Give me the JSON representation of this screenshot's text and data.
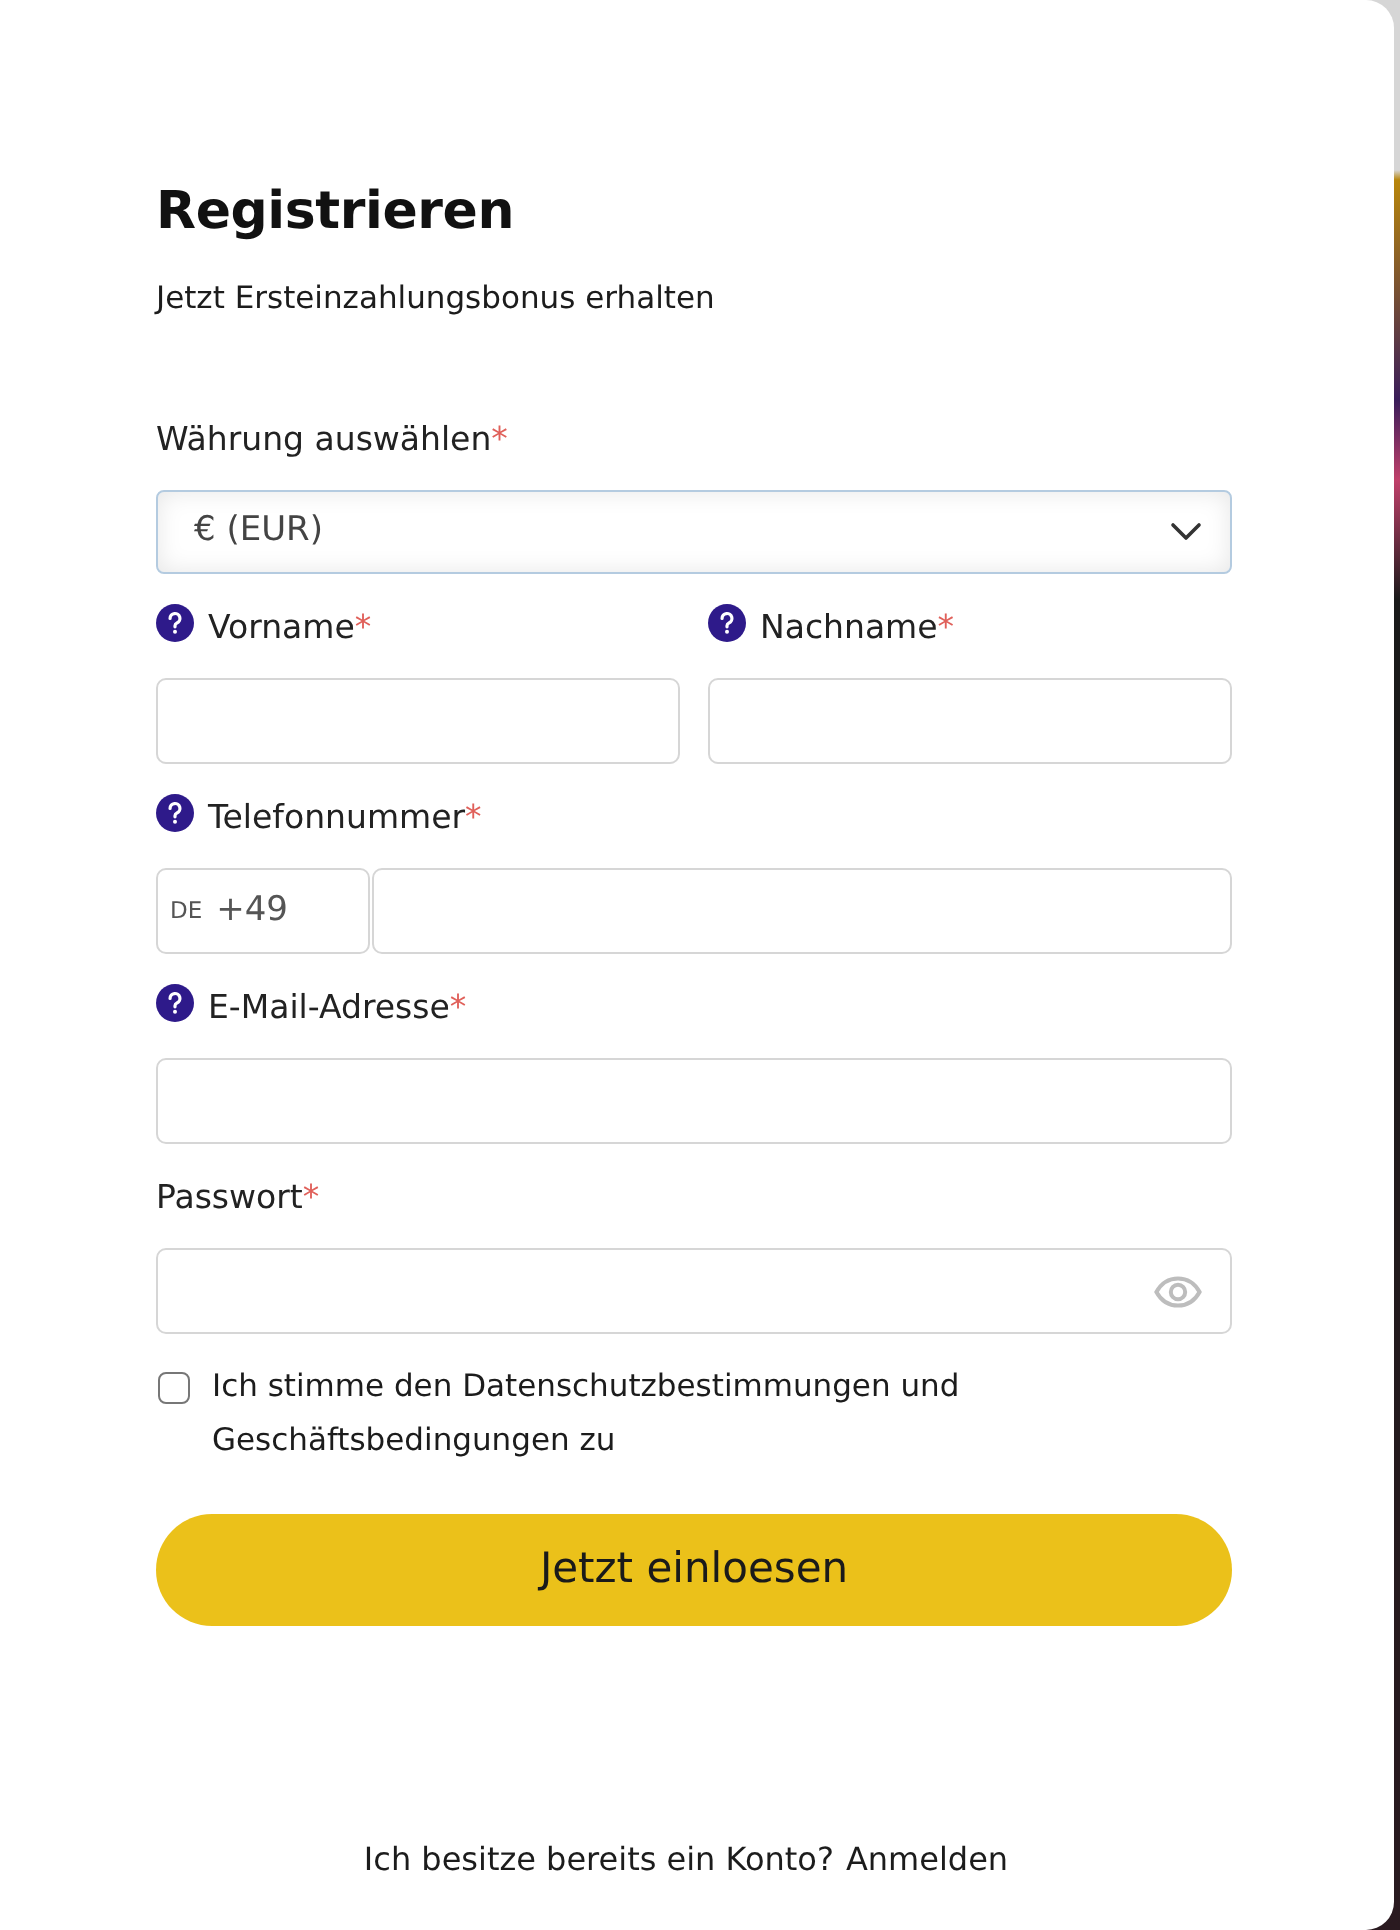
{
  "title": "Registrieren",
  "subtitle": "Jetzt Ersteinzahlungsbonus erhalten",
  "fields": [
    {
      "kind": "select",
      "label": "Währung auswählen",
      "marker": "*",
      "help": false,
      "value": "€ (EUR)"
    },
    {
      "kind": "pair",
      "items": [
        {
          "label": "Vorname",
          "marker": "*",
          "help": true
        },
        {
          "label": "Nachname",
          "marker": "*",
          "help": true
        }
      ]
    },
    {
      "kind": "phone",
      "label": "Telefonnummer",
      "marker": "*",
      "help": true,
      "country": "DE",
      "prefix": "+49"
    },
    {
      "kind": "text",
      "label": "E-Mail-Adresse",
      "marker": "*",
      "help": true
    },
    {
      "kind": "password",
      "label": "Passwort",
      "marker": "*",
      "help": false
    }
  ],
  "consent": {
    "text": "Ich stimme den Datenschutzbestimmungen und Geschäftsbedingungen zu",
    "checked": false
  },
  "submit": "Jetzt einloesen",
  "login": {
    "prompt": "Ich besitze bereits ein Konto?",
    "link": "Anmelden"
  }
}
